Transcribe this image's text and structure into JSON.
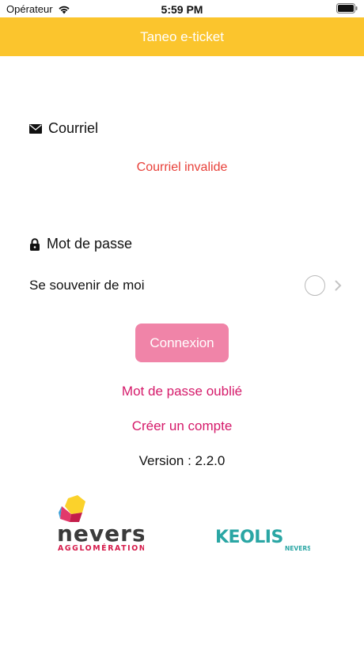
{
  "status_bar": {
    "carrier": "Opérateur",
    "time": "5:59 PM"
  },
  "navbar": {
    "title": "Taneo e-ticket"
  },
  "form": {
    "email_label": "Courriel",
    "email_error": "Courriel invalide",
    "password_label": "Mot de passe",
    "remember_label": "Se souvenir de moi",
    "remember_checked": false
  },
  "actions": {
    "connect_label": "Connexion",
    "forgot_password": "Mot de passe oublié",
    "create_account": "Créer un compte"
  },
  "version_text": "Version : 2.2.0",
  "logos": {
    "nevers_word": "nevers",
    "nevers_sub": "AGGLOMÉRATION",
    "keolis_word": "KEOLIS",
    "keolis_sub": "NEVERS"
  },
  "colors": {
    "navbar": "#fbc52d",
    "error": "#e8413a",
    "link": "#d51a6a",
    "button": "#f084a8",
    "keolis": "#2aa6a4"
  }
}
